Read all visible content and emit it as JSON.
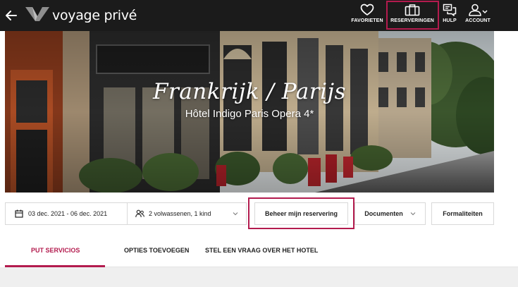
{
  "header": {
    "logo_text": "voyage privé",
    "nav": {
      "favorites": {
        "label": "FAVORIETEN",
        "icon": "heart-icon"
      },
      "reservations": {
        "label": "RESERVERINGEN",
        "icon": "briefcase-icon"
      },
      "help": {
        "label": "HULP",
        "icon": "help-chat-icon"
      },
      "account": {
        "label": "ACCOUNT",
        "icon": "user-icon"
      }
    }
  },
  "hero": {
    "title": "Frankrijk / Parijs",
    "subtitle": "Hôtel Indigo Paris Opera 4*"
  },
  "booking": {
    "dates": "03 dec. 2021 - 06 dec. 2021",
    "guests": "2 volwassenen, 1 kind",
    "manage_label": "Beheer mijn reservering",
    "documents_label": "Documenten",
    "formalities_label": "Formaliteiten"
  },
  "tabs": [
    {
      "label": "PUT SERVICIOS",
      "active": true
    },
    {
      "label": "OPTIES TOEVOEGEN",
      "active": false
    },
    {
      "label": "STEL EEN VRAAG OVER HET HOTEL",
      "active": false
    }
  ],
  "colors": {
    "accent": "#b31b4e",
    "header_bg": "#1b1b1b"
  }
}
